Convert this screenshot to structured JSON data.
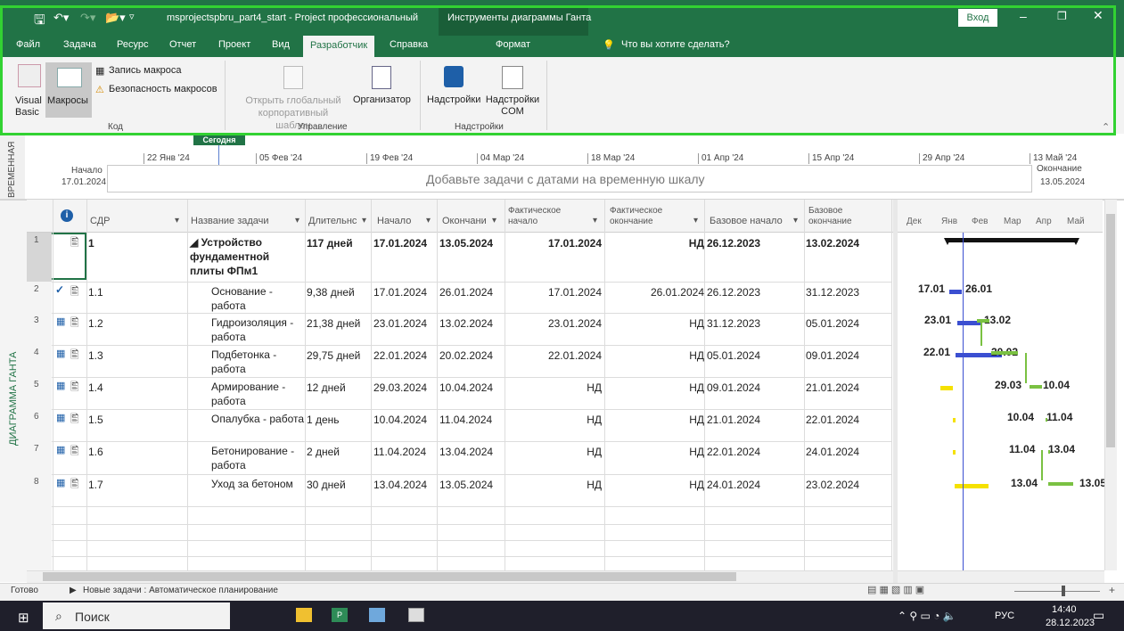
{
  "title": {
    "quick": "msprojectspbru_part4_start - Project профессиональный",
    "context": "Инструменты диаграммы Ганта",
    "login": "Вход"
  },
  "tabs": [
    "Файл",
    "Задача",
    "Ресурс",
    "Отчет",
    "Проект",
    "Вид",
    "Разработчик",
    "Справка",
    "Формат"
  ],
  "search": "Что вы хотите сделать?",
  "ribbon": {
    "visual_basic": "Visual Basic",
    "macros": "Макросы",
    "record": "Запись макроса",
    "security": "Безопасность макросов",
    "group_code": "Код",
    "open_global": "Открыть глобальный корпоративный шаблон",
    "organizer": "Организатор",
    "group_manage": "Управление",
    "addins": "Надстройки",
    "com_addins": "Надстройки COM",
    "group_addins": "Надстройки"
  },
  "timeline": {
    "side_label": "ВРЕМЕННАЯ",
    "today": "Сегодня",
    "ticks": [
      "22 Янв '24",
      "05 Фев '24",
      "19 Фев '24",
      "04 Мар '24",
      "18 Мар '24",
      "01 Апр '24",
      "15 Апр '24",
      "29 Апр '24",
      "13 Май '24"
    ],
    "start_label": "Начало",
    "start_date": "17.01.2024",
    "end_label": "Окончание",
    "end_date": "13.05.2024",
    "placeholder": "Добавьте задачи с датами на временную шкалу"
  },
  "columns": {
    "info": "i",
    "wbs": "СДР",
    "name": "Название задачи",
    "duration": "Длительнс",
    "start": "Начало",
    "finish": "Окончани",
    "act_start": "Фактическое начало",
    "act_finish": "Фактическое окончание",
    "base_start": "Базовое начало",
    "base_finish": "Базовое окончание"
  },
  "side_gantt": "ДИАГРАММА ГАНТА",
  "gantt_months": [
    "Дек",
    "Янв",
    "Фев",
    "Мар",
    "Апр",
    "Май"
  ],
  "tasks": [
    {
      "id": "1",
      "wbs": "1",
      "name": "◢ Устройство фундаментной плиты ФПм1",
      "dur": "117 дней",
      "start": "17.01.2024",
      "finish": "13.05.2024",
      "as": "17.01.2024",
      "af": "НД",
      "bs": "26.12.2023",
      "bf": "13.02.2024"
    },
    {
      "id": "2",
      "wbs": "1.1",
      "name": "Основание - работа",
      "dur": "9,38 дней",
      "start": "17.01.2024",
      "finish": "26.01.2024",
      "as": "17.01.2024",
      "af": "26.01.2024",
      "bs": "26.12.2023",
      "bf": "31.12.2023",
      "l": "17.01",
      "r": "26.01"
    },
    {
      "id": "3",
      "wbs": "1.2",
      "name": "Гидроизоляция - работа",
      "dur": "21,38 дней",
      "start": "23.01.2024",
      "finish": "13.02.2024",
      "as": "23.01.2024",
      "af": "НД",
      "bs": "31.12.2023",
      "bf": "05.01.2024",
      "l": "23.01",
      "r": "13.02"
    },
    {
      "id": "4",
      "wbs": "1.3",
      "name": "Подбетонка - работа",
      "dur": "29,75 дней",
      "start": "22.01.2024",
      "finish": "20.02.2024",
      "as": "22.01.2024",
      "af": "НД",
      "bs": "05.01.2024",
      "bf": "09.01.2024",
      "l": "22.01",
      "r": "20.02"
    },
    {
      "id": "5",
      "wbs": "1.4",
      "name": "Армирование - работа",
      "dur": "12 дней",
      "start": "29.03.2024",
      "finish": "10.04.2024",
      "as": "НД",
      "af": "НД",
      "bs": "09.01.2024",
      "bf": "21.01.2024",
      "l": "29.03",
      "r": "10.04"
    },
    {
      "id": "6",
      "wbs": "1.5",
      "name": "Опалубка - работа",
      "dur": "1 день",
      "start": "10.04.2024",
      "finish": "11.04.2024",
      "as": "НД",
      "af": "НД",
      "bs": "21.01.2024",
      "bf": "22.01.2024",
      "l": "10.04",
      "r": "11.04"
    },
    {
      "id": "7",
      "wbs": "1.6",
      "name": "Бетонирование - работа",
      "dur": "2 дней",
      "start": "11.04.2024",
      "finish": "13.04.2024",
      "as": "НД",
      "af": "НД",
      "bs": "22.01.2024",
      "bf": "24.01.2024",
      "l": "11.04",
      "r": "13.04"
    },
    {
      "id": "8",
      "wbs": "1.7",
      "name": "Уход за бетоном",
      "dur": "30 дней",
      "start": "13.04.2024",
      "finish": "13.05.2024",
      "as": "НД",
      "af": "НД",
      "bs": "24.01.2024",
      "bf": "23.02.2024",
      "l": "13.04",
      "r": "13.05"
    }
  ],
  "status": {
    "ready": "Готово",
    "mode": "Новые задачи : Автоматическое планирование"
  },
  "taskbar": {
    "search": "Поиск",
    "lang": "РУС",
    "time": "14:40",
    "date": "28.12.2023"
  }
}
